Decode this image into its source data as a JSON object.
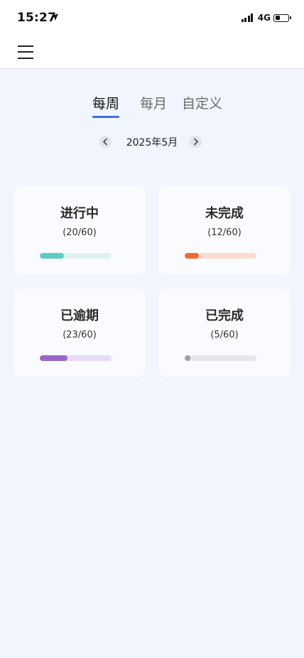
{
  "status_bar": {
    "time": "15:27",
    "network": "4G",
    "icons": [
      "location-arrow-icon",
      "signal-icon",
      "battery-icon"
    ],
    "battery_level": 0.35
  },
  "header": {
    "menu_icon": "hamburger-menu-icon"
  },
  "tabs": [
    {
      "label": "每周",
      "active": true
    },
    {
      "label": "每月",
      "active": false
    },
    {
      "label": "自定义",
      "active": false
    }
  ],
  "month_nav": {
    "label": "2025年5月",
    "prev_icon": "chevron-left-icon",
    "next_icon": "chevron-right-icon"
  },
  "cards": [
    {
      "title": "进行中",
      "count": "(20/60)",
      "progress": 0.3333,
      "color": "#5ecbc6",
      "track_color": "#dff2f1"
    },
    {
      "title": "未完成",
      "count": "(12/60)",
      "progress": 0.2,
      "color": "#f26a2f",
      "track_color": "#fbdbcd"
    },
    {
      "title": "已逾期",
      "count": "(23/60)",
      "progress": 0.3833,
      "color": "#9966cc",
      "track_color": "#e6dcf5"
    },
    {
      "title": "已完成",
      "count": "(5/60)",
      "progress": 0.0833,
      "color": "#a0a0a0",
      "track_color": "#e6e6e8"
    }
  ],
  "colors": {
    "accent": "#3f6fe7",
    "background": "#f1f5fe"
  }
}
